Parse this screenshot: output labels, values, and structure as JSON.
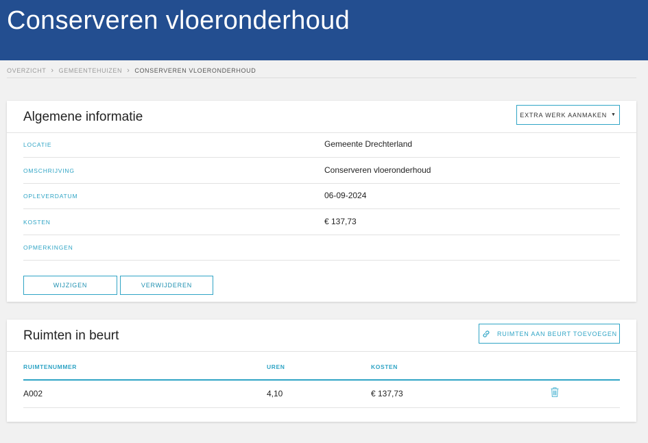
{
  "header": {
    "title": "Conserveren vloeronderhoud"
  },
  "breadcrumb": {
    "items": [
      "OVERZICHT",
      "GEMEENTEHUIZEN"
    ],
    "current": "CONSERVEREN VLOERONDERHOUD"
  },
  "general_info": {
    "title": "Algemene informatie",
    "extra_work_label": "EXTRA WERK AANMAKEN",
    "fields": [
      {
        "label": "LOCATIE",
        "value": "Gemeente Drechterland"
      },
      {
        "label": "OMSCHRIJVING",
        "value": "Conserveren vloeronderhoud"
      },
      {
        "label": "OPLEVERDATUM",
        "value": "06-09-2024"
      },
      {
        "label": "KOSTEN",
        "value": "€ 137,73"
      },
      {
        "label": "OPMERKINGEN",
        "value": ""
      }
    ],
    "edit_label": "WIJZIGEN",
    "delete_label": "VERWIJDEREN"
  },
  "rooms": {
    "title": "Ruimten in beurt",
    "add_label": "RUIMTEN AAN BEURT TOEVOEGEN",
    "columns": [
      "RUIMTENUMMER",
      "UREN",
      "KOSTEN"
    ],
    "rows": [
      {
        "number": "A002",
        "hours": "4,10",
        "cost": "€ 137,73"
      }
    ]
  },
  "colors": {
    "header": "#234e90",
    "accent": "#2fa4c5"
  },
  "icons": {
    "breadcrumb_separator": "chevron-right-icon",
    "dropdown": "caret-down-icon",
    "add": "link-icon",
    "delete": "trash-icon"
  }
}
